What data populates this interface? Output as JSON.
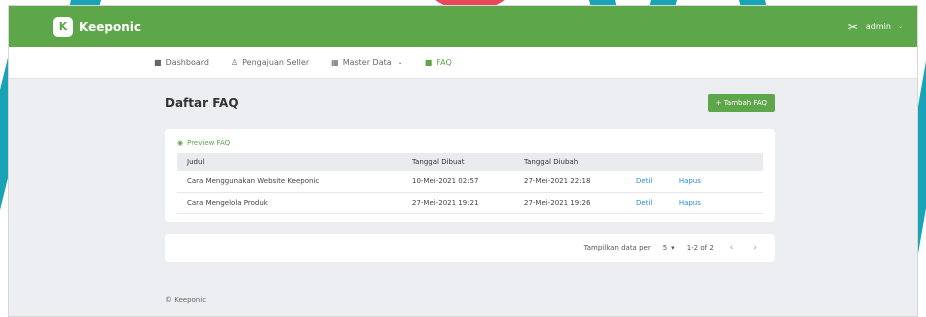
{
  "header": {
    "brand_name": "Keeponic",
    "logo_glyph": "K",
    "user_label": "admin",
    "user_caret": "⌄",
    "user_icon_glyph": "✂"
  },
  "nav": {
    "items": [
      {
        "label": "Dashboard",
        "icon": "grid-icon",
        "glyph": "■"
      },
      {
        "label": "Pengajuan Seller",
        "icon": "user-icon",
        "glyph": "♙"
      },
      {
        "label": "Master Data",
        "icon": "database-icon",
        "glyph": "▦",
        "caret": "⌄"
      },
      {
        "label": "FAQ",
        "icon": "faq-icon",
        "glyph": "■"
      }
    ]
  },
  "page": {
    "title": "Daftar FAQ",
    "add_button": "+ Tambah FAQ",
    "preview_label": "Preview FAQ",
    "preview_glyph": "◉"
  },
  "table": {
    "columns": [
      "Judul",
      "Tanggal Dibuat",
      "Tanggal Diubah"
    ],
    "rows": [
      {
        "judul": "Cara Menggunakan Website Keeponic",
        "dibuat": "10-Mei-2021 02:57",
        "diubah": "27-Mei-2021 22:18",
        "detail": "Detil",
        "hapus": "Hapus"
      },
      {
        "judul": "Cara Mengelola Produk",
        "dibuat": "27-Mei-2021 19:21",
        "diubah": "27-Mei-2021 19:26",
        "detail": "Detil",
        "hapus": "Hapus"
      }
    ]
  },
  "pagination": {
    "per_page_label": "Tampilkan data per",
    "per_page_value": "5",
    "select_caret": "▾",
    "range": "1-2 of 2",
    "prev": "‹",
    "next": "›"
  },
  "footer": {
    "text": "© Keeponic"
  },
  "colors": {
    "primary": "#5ea64a",
    "link": "#2a8fd6",
    "background": "#eceef1",
    "accent_teal": "#19a4b5",
    "accent_red": "#e8495a"
  }
}
